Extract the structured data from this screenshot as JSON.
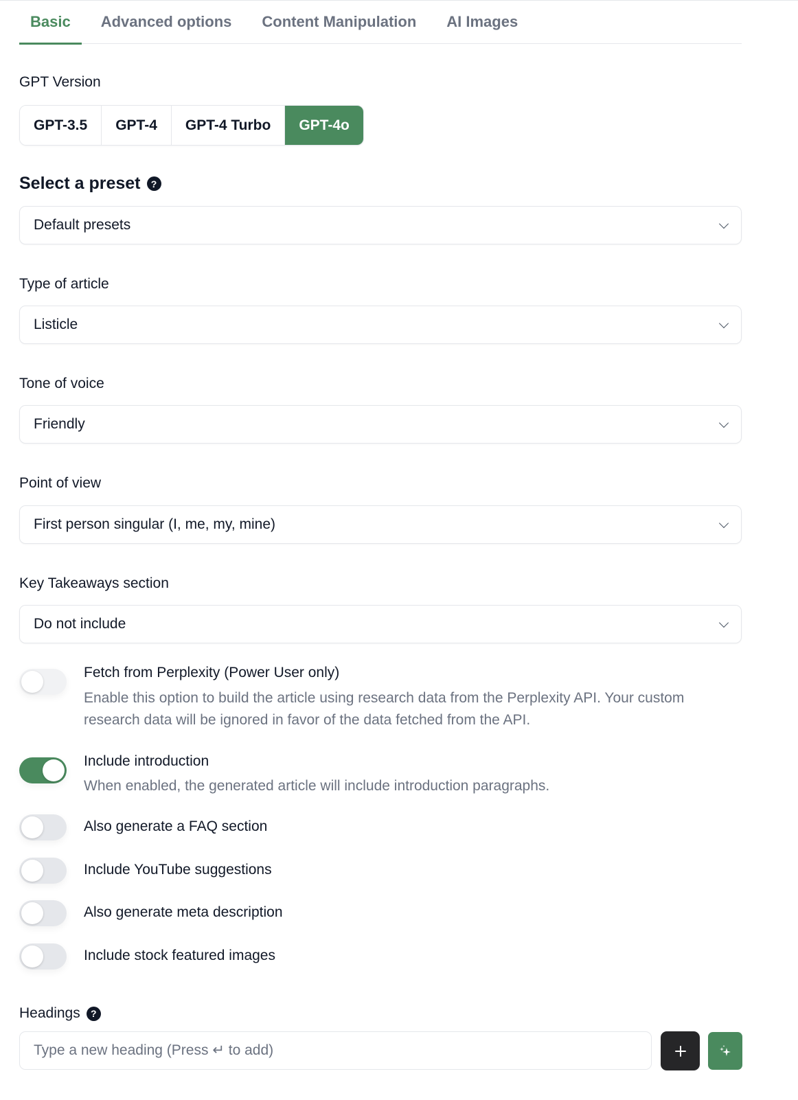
{
  "tabs": [
    {
      "label": "Basic",
      "active": true
    },
    {
      "label": "Advanced options",
      "active": false
    },
    {
      "label": "Content Manipulation",
      "active": false
    },
    {
      "label": "AI Images",
      "active": false
    }
  ],
  "gpt_version": {
    "label": "GPT Version",
    "options": [
      "GPT-3.5",
      "GPT-4",
      "GPT-4 Turbo",
      "GPT-4o"
    ],
    "selected": "GPT-4o"
  },
  "preset": {
    "label": "Select a preset",
    "help_icon": "question-circle-icon",
    "value": "Default presets"
  },
  "article_type": {
    "label": "Type of article",
    "value": "Listicle"
  },
  "tone": {
    "label": "Tone of voice",
    "value": "Friendly"
  },
  "point_of_view": {
    "label": "Point of view",
    "value": "First person singular (I, me, my, mine)"
  },
  "key_takeaways": {
    "label": "Key Takeaways section",
    "value": "Do not include"
  },
  "toggles": [
    {
      "title": "Fetch from Perplexity (Power User only)",
      "description": "Enable this option to build the article using research data from the Perplexity API. Your custom research data will be ignored in favor of the data fetched from the API.",
      "on": false
    },
    {
      "title": "Include introduction",
      "description": "When enabled, the generated article will include introduction paragraphs.",
      "on": true
    },
    {
      "title": "Also generate a FAQ section",
      "on": false
    },
    {
      "title": "Include YouTube suggestions",
      "on": false
    },
    {
      "title": "Also generate meta description",
      "on": false
    },
    {
      "title": "Include stock featured images",
      "on": false
    }
  ],
  "headings": {
    "label": "Headings",
    "help_icon": "question-circle-icon",
    "placeholder": "Type a new heading (Press ↵ to add)",
    "add_icon": "plus-icon",
    "ai_icon": "sparkles-icon"
  },
  "colors": {
    "accent": "#4a8a5e",
    "dark_button": "#262628",
    "text": "#111827",
    "muted": "#6b7280"
  }
}
